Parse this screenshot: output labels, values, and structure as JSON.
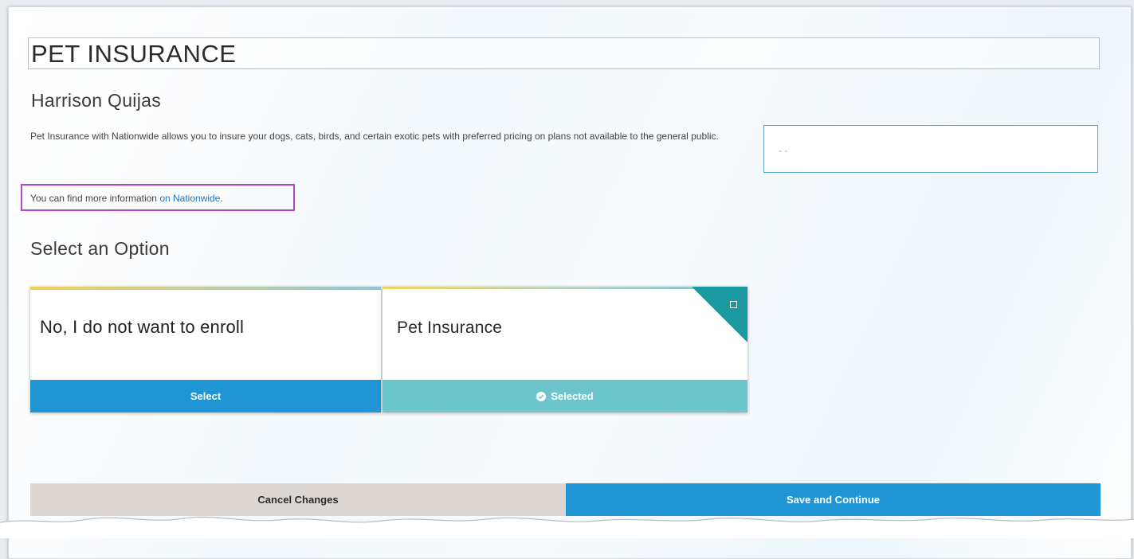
{
  "page": {
    "title": "PET INSURANCE",
    "person_name": "Harrison Quijas",
    "description": "Pet Insurance with Nationwide allows you to insure your dogs, cats, birds, and certain exotic pets with preferred pricing on plans not available to the general public.",
    "info_prefix": "You can find more information ",
    "info_link": "on Nationwide",
    "info_suffix": ".",
    "side_value": "- -",
    "section_title": "Select an Option"
  },
  "options": [
    {
      "label": "No, I do not want to enroll",
      "button_label": "Select",
      "selected": false
    },
    {
      "label": "Pet Insurance",
      "button_label": "Selected",
      "selected": true
    }
  ],
  "footer": {
    "cancel_label": "Cancel Changes",
    "save_label": "Save and Continue"
  },
  "icons": {
    "selected_check": "check-circle-icon",
    "corner_selected": "checkbox-icon"
  },
  "colors": {
    "primary_button": "#1f95d6",
    "selected_button": "#6cc5cb",
    "selected_corner": "#1a9aa0",
    "cancel_button": "#ddd7d3",
    "highlight_border": "#b248c8",
    "link": "#2773b8"
  }
}
